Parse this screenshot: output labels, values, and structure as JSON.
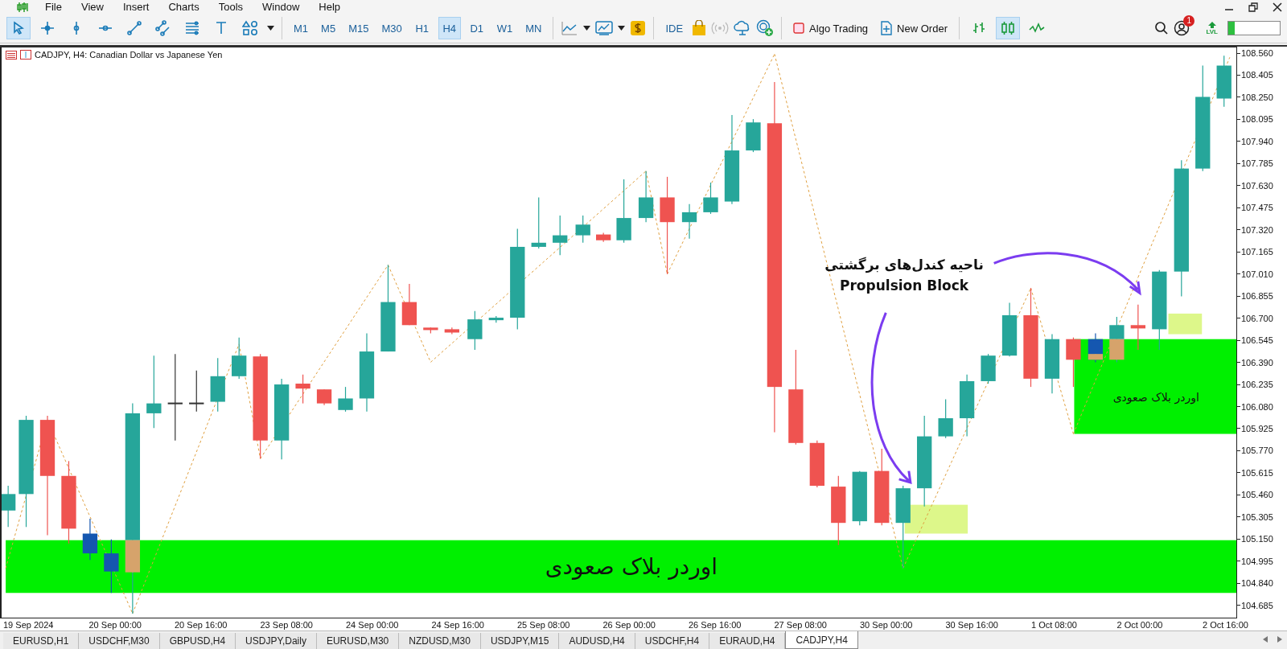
{
  "menu": [
    {
      "label": "File"
    },
    {
      "label": "View"
    },
    {
      "label": "Insert"
    },
    {
      "label": "Charts"
    },
    {
      "label": "Tools"
    },
    {
      "label": "Window"
    },
    {
      "label": "Help"
    }
  ],
  "toolbar": {
    "tools": [
      {
        "kind": "cursor",
        "selected": true
      },
      {
        "kind": "crosshair",
        "selected": false
      },
      {
        "kind": "vline",
        "selected": false
      },
      {
        "kind": "hline",
        "selected": false
      },
      {
        "kind": "trendline",
        "selected": false
      },
      {
        "kind": "channel",
        "selected": false
      },
      {
        "kind": "fibo",
        "selected": false
      },
      {
        "kind": "text",
        "selected": false
      },
      {
        "kind": "shapes",
        "selected": false
      }
    ],
    "timeframes": [
      {
        "label": "M1",
        "selected": false
      },
      {
        "label": "M5",
        "selected": false
      },
      {
        "label": "M15",
        "selected": false
      },
      {
        "label": "M30",
        "selected": false
      },
      {
        "label": "H1",
        "selected": false
      },
      {
        "label": "H4",
        "selected": true
      },
      {
        "label": "D1",
        "selected": false
      },
      {
        "label": "W1",
        "selected": false
      },
      {
        "label": "MN",
        "selected": false
      }
    ],
    "ide": "IDE",
    "algo_trading": "Algo Trading",
    "new_order": "New Order",
    "chart_types": [
      {
        "kind": "bars",
        "selected": false
      },
      {
        "kind": "candles",
        "selected": true
      },
      {
        "kind": "line",
        "selected": false
      }
    ],
    "notifications": "1",
    "lvl": "LVL",
    "meter": {
      "level": 0.12
    }
  },
  "chart": {
    "title": "CADJPY, H4:  Canadian Dollar vs Japanese Yen",
    "annotation": [
      "ناحیه کندل‌های برگشتی",
      "Propulsion Block"
    ],
    "zones": [
      {
        "kind": "large",
        "label": "اوردر بلاک صعودی"
      },
      {
        "kind": "small",
        "label": "اوردر بلاک صعودی"
      }
    ],
    "price_axis": [
      "108.560",
      "108.405",
      "108.250",
      "108.095",
      "107.940",
      "107.785",
      "107.630",
      "107.475",
      "107.320",
      "107.165",
      "107.010",
      "106.855",
      "106.700",
      "106.545",
      "106.390",
      "106.235",
      "106.080",
      "105.925",
      "105.770",
      "105.615",
      "105.460",
      "105.305",
      "105.150",
      "104.995",
      "104.840",
      "104.685"
    ],
    "time_axis": [
      "19 Sep 2024",
      "20 Sep 00:00",
      "20 Sep 16:00",
      "23 Sep 08:00",
      "24 Sep 00:00",
      "24 Sep 16:00",
      "25 Sep 08:00",
      "26 Sep 00:00",
      "26 Sep 16:00",
      "27 Sep 08:00",
      "30 Sep 00:00",
      "30 Sep 16:00",
      "1 Oct 08:00",
      "2 Oct 00:00",
      "2 Oct 16:00"
    ]
  },
  "tabs": [
    {
      "label": "EURUSD,H1",
      "selected": false
    },
    {
      "label": "USDCHF,M30",
      "selected": false
    },
    {
      "label": "GBPUSD,H4",
      "selected": false
    },
    {
      "label": "USDJPY,Daily",
      "selected": false
    },
    {
      "label": "EURUSD,M30",
      "selected": false
    },
    {
      "label": "NZDUSD,M30",
      "selected": false
    },
    {
      "label": "USDJPY,M15",
      "selected": false
    },
    {
      "label": "AUDUSD,H4",
      "selected": false
    },
    {
      "label": "USDCHF,H4",
      "selected": false
    },
    {
      "label": "EURAUD,H4",
      "selected": false
    },
    {
      "label": "CADJPY,H4",
      "selected": true
    }
  ]
}
